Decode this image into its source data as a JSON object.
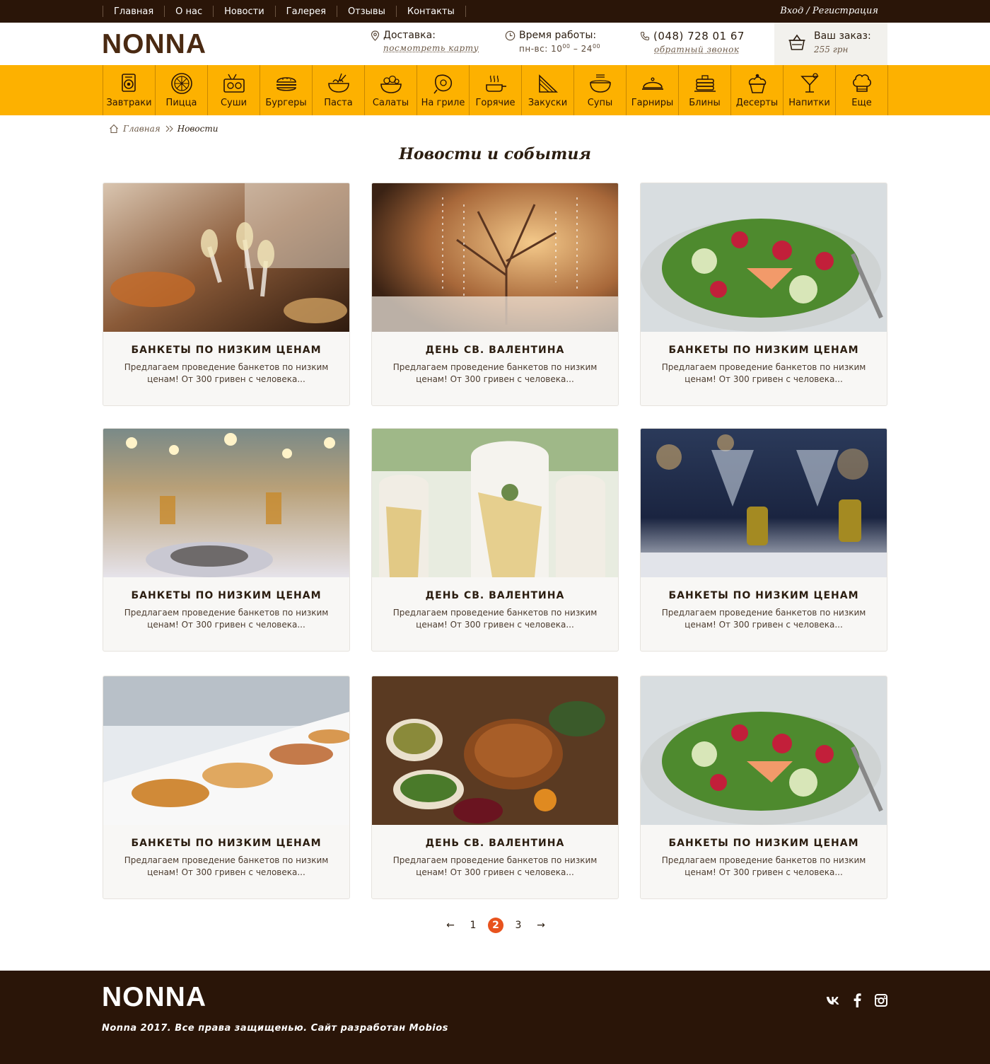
{
  "topnav": [
    "Главная",
    "О нас",
    "Новости",
    "Галерея",
    "Отзывы",
    "Контакты"
  ],
  "login": "Вход / Регистрация",
  "brand": "NONNA",
  "delivery": {
    "title": "Доставка:",
    "link": "посмотреть карту"
  },
  "hours": {
    "title": "Время работы:",
    "days": "пн-вс:",
    "open": "10",
    "open_min": "00",
    "close": "24",
    "close_min": "00"
  },
  "phone": {
    "number": "(048) 728 01 67",
    "link": "обратный звонок"
  },
  "cart": {
    "title": "Ваш заказ:",
    "sum": "255 грн"
  },
  "categories": [
    {
      "label": "Завтраки",
      "icon": "breakfast-icon"
    },
    {
      "label": "Пицца",
      "icon": "pizza-icon"
    },
    {
      "label": "Суши",
      "icon": "sushi-icon"
    },
    {
      "label": "Бургеры",
      "icon": "burger-icon"
    },
    {
      "label": "Паста",
      "icon": "pasta-icon"
    },
    {
      "label": "Салаты",
      "icon": "salad-icon"
    },
    {
      "label": "На гриле",
      "icon": "grill-icon"
    },
    {
      "label": "Горячие",
      "icon": "hot-dish-icon"
    },
    {
      "label": "Закуски",
      "icon": "snacks-icon"
    },
    {
      "label": "Супы",
      "icon": "soup-icon"
    },
    {
      "label": "Гарниры",
      "icon": "cloche-icon"
    },
    {
      "label": "Блины",
      "icon": "pancakes-icon"
    },
    {
      "label": "Десерты",
      "icon": "dessert-icon"
    },
    {
      "label": "Напитки",
      "icon": "cocktail-icon"
    },
    {
      "label": "Еще",
      "icon": "chef-hat-icon"
    }
  ],
  "breadcrumb": {
    "home": "Главная",
    "current": "Новости"
  },
  "page_title": "Новости и события",
  "news": [
    {
      "title": "БАНКЕТЫ ПО НИЗКИМ ЦЕНАМ",
      "text": "Предлагаем проведение банкетов по низким ценам! От 300 гривен с человека...",
      "photo": "toast-photo"
    },
    {
      "title": "ДЕНЬ СВ. ВАЛЕНТИНА",
      "text": "Предлагаем проведение банкетов по низким ценам! От 300 гривен с человека...",
      "photo": "decor-photo"
    },
    {
      "title": "БАНКЕТЫ ПО НИЗКИМ ЦЕНАМ",
      "text": "Предлагаем проведение банкетов по низким ценам! От 300 гривен с человека...",
      "photo": "salad-photo"
    },
    {
      "title": "БАНКЕТЫ ПО НИЗКИМ ЦЕНАМ",
      "text": "Предлагаем проведение банкетов по низким ценам! От 300 гривен с человека...",
      "photo": "table-photo"
    },
    {
      "title": "ДЕНЬ СВ. ВАЛЕНТИНА",
      "text": "Предлагаем проведение банкетов по низким ценам! От 300 гривен с человека...",
      "photo": "chairs-photo"
    },
    {
      "title": "БАНКЕТЫ ПО НИЗКИМ ЦЕНАМ",
      "text": "Предлагаем проведение банкетов по низким ценам! От 300 гривен с человека...",
      "photo": "glasses-photo"
    },
    {
      "title": "БАНКЕТЫ ПО НИЗКИМ ЦЕНАМ",
      "text": "Предлагаем проведение банкетов по низким ценам! От 300 гривен с человека...",
      "photo": "buffet-photo"
    },
    {
      "title": "ДЕНЬ СВ. ВАЛЕНТИНА",
      "text": "Предлагаем проведение банкетов по низким ценам! От 300 гривен с человека...",
      "photo": "turkey-photo"
    },
    {
      "title": "БАНКЕТЫ ПО НИЗКИМ ЦЕНАМ",
      "text": "Предлагаем проведение банкетов по низким ценам! От 300 гривен с человека...",
      "photo": "salad-photo"
    }
  ],
  "pagination": {
    "pages": [
      "1",
      "2",
      "3"
    ],
    "current": "2",
    "prev": "←",
    "next": "→"
  },
  "footer": {
    "brand": "NONNA",
    "copyright": "Nonna 2017. Все права защищенью. Сайт разработан Mobios",
    "socials": [
      "vk-icon",
      "facebook-icon",
      "instagram-icon"
    ]
  },
  "colors": {
    "dark": "#2a1508",
    "accent": "#fdb100",
    "active": "#e8531e"
  }
}
